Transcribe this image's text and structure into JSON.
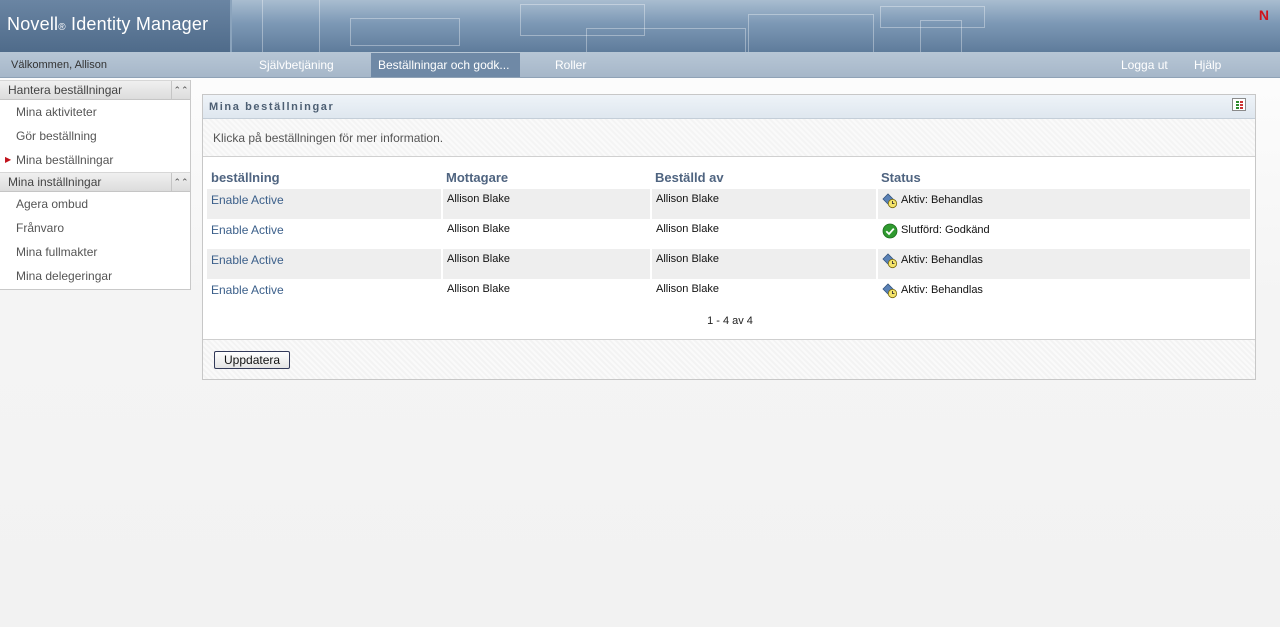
{
  "header": {
    "brand_name": "Novell",
    "brand_reg": "®",
    "brand_product": "Identity Manager",
    "logo_letter": "N",
    "logo_color": "#d0141b"
  },
  "navbar": {
    "welcome": "Välkommen, Allison",
    "tabs": [
      {
        "label": "Självbetjäning",
        "active": false
      },
      {
        "label": "Beställningar och godk...",
        "active": true
      },
      {
        "label": "Roller",
        "active": false
      }
    ],
    "logout": "Logga ut",
    "help": "Hjälp"
  },
  "sidebar": {
    "sections": [
      {
        "title": "Hantera beställningar",
        "items": [
          {
            "label": "Mina aktiviteter",
            "selected": false
          },
          {
            "label": "Gör beställning",
            "selected": false
          },
          {
            "label": "Mina beställningar",
            "selected": true
          }
        ]
      },
      {
        "title": "Mina inställningar",
        "items": [
          {
            "label": "Agera ombud",
            "selected": false
          },
          {
            "label": "Frånvaro",
            "selected": false
          },
          {
            "label": "Mina fullmakter",
            "selected": false
          },
          {
            "label": "Mina delegeringar",
            "selected": false
          }
        ]
      }
    ]
  },
  "panel": {
    "title": "Mina beställningar",
    "instructions": "Klicka på beställningen för mer information.",
    "columns": [
      "beställning",
      "Mottagare",
      "Beställd av",
      "Status"
    ],
    "rows": [
      {
        "request": "Enable Active",
        "recipient": "Allison Blake",
        "requested_by": "Allison Blake",
        "status": "Aktiv: Behandlas",
        "status_icon": "pending-clock-icon"
      },
      {
        "request": "Enable Active",
        "recipient": "Allison Blake",
        "requested_by": "Allison Blake",
        "status": "Slutförd: Godkänd",
        "status_icon": "approved-check-icon"
      },
      {
        "request": "Enable Active",
        "recipient": "Allison Blake",
        "requested_by": "Allison Blake",
        "status": "Aktiv: Behandlas",
        "status_icon": "pending-clock-icon"
      },
      {
        "request": "Enable Active",
        "recipient": "Allison Blake",
        "requested_by": "Allison Blake",
        "status": "Aktiv: Behandlas",
        "status_icon": "pending-clock-icon"
      }
    ],
    "pager": "1 - 4 av 4",
    "refresh_label": "Uppdatera"
  },
  "colors": {
    "link": "#3b5f8a",
    "header_text": "#4f6480",
    "nav_active": "#6f89a6",
    "approved": "#2f9a2f"
  }
}
